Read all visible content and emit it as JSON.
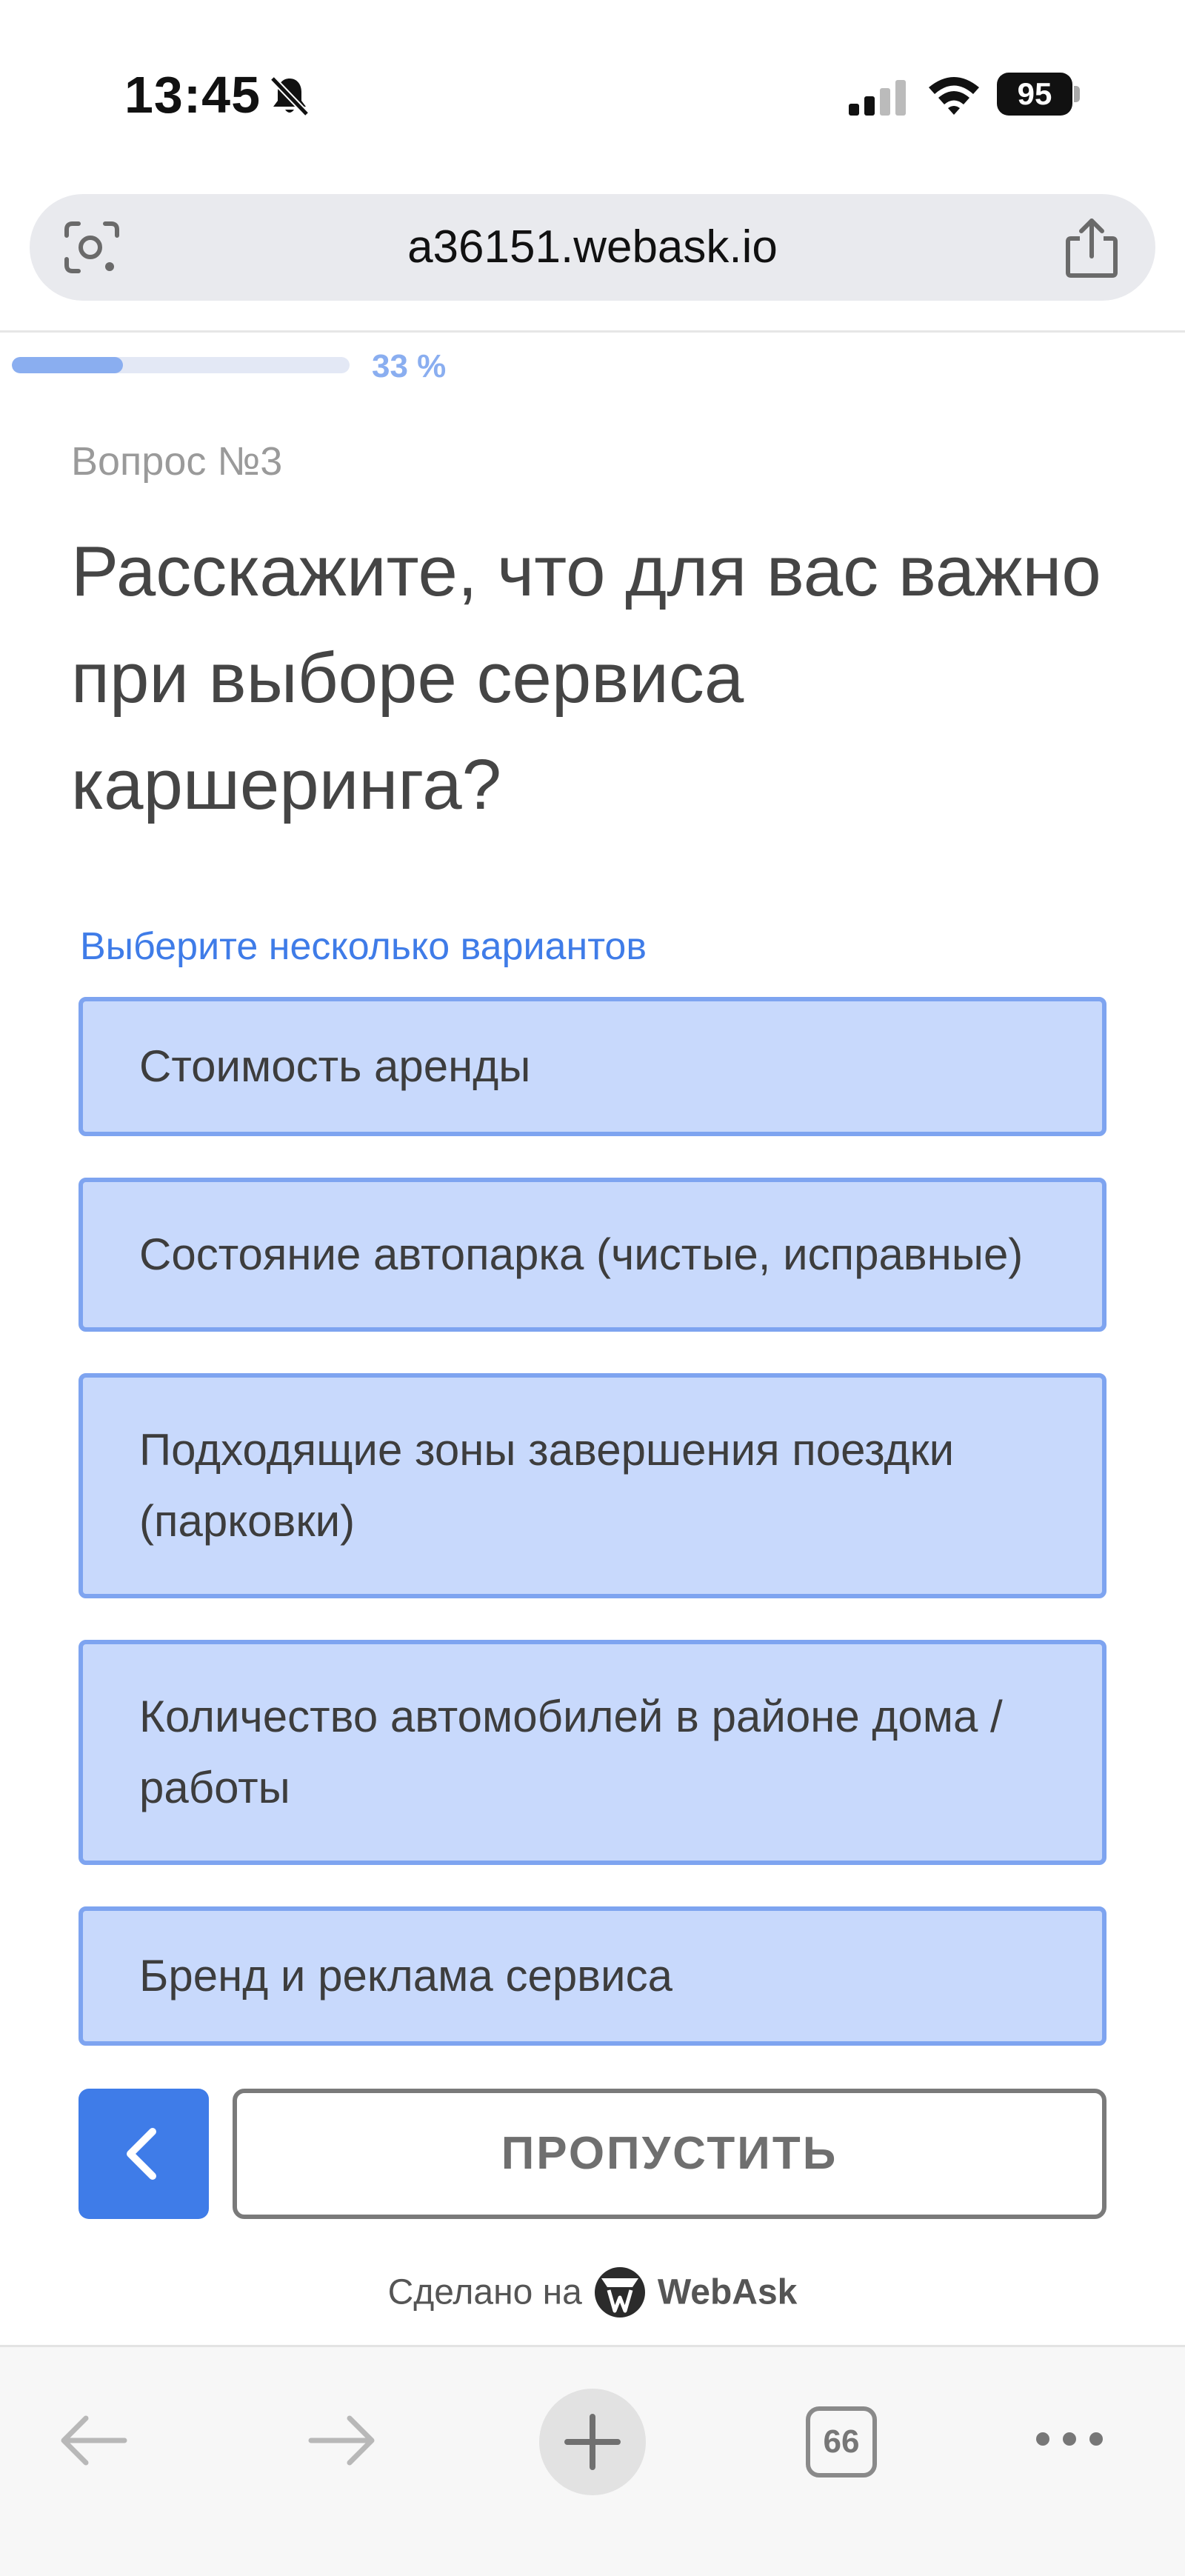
{
  "status_bar": {
    "time": "13:45",
    "battery": "95",
    "icons": [
      "bell-slash-icon",
      "signal-icon",
      "wifi-icon",
      "battery-icon"
    ]
  },
  "browser": {
    "url": "a36151.webask.io",
    "icons": [
      "lens-icon",
      "share-icon"
    ]
  },
  "progress": {
    "value": 0.33,
    "label": "33 %"
  },
  "question": {
    "number": "Вопрос №3",
    "title": "Расскажите, что для вас важно при выборе сервиса каршеринга?",
    "hint": "Выберите несколько вариантов",
    "options": [
      {
        "label": "Стоимость аренды"
      },
      {
        "label": "Состояние автопарка (чистые, исправные)"
      },
      {
        "label": "Подходящие зоны завершения поездки (парковки)"
      },
      {
        "label": "Количество автомобилей в районе дома / работы"
      },
      {
        "label": "Бренд и реклама сервиса"
      }
    ]
  },
  "navigation": {
    "back_icon": "chevron-left-icon",
    "skip_label": "ПРОПУСТИТЬ"
  },
  "footer": {
    "made_with": "Сделано на",
    "brand": "WebAsk"
  },
  "toolbar": {
    "tab_count": "66",
    "icons": [
      "arrow-left-icon",
      "arrow-right-icon",
      "plus-icon",
      "tabs-icon",
      "more-icon"
    ]
  },
  "colors": {
    "accent": "#3f7ce8",
    "option_bg": "#c8d9fc",
    "option_border": "#7ea4f0",
    "progress": "#8aaef0"
  }
}
